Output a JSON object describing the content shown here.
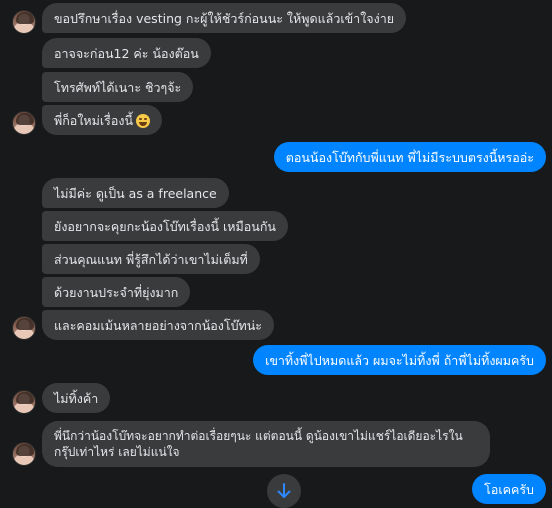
{
  "messages": [
    {
      "text": "ขอปรึกษาเรื่อง vesting กะผู้ให้ชัวร์ก่อนนะ ให้พูดแล้วเข้าใจง่าย"
    },
    {
      "text": "อาจจะก่อน12 ค่ะ น้องต๊อน"
    },
    {
      "text": "โทรศัพท์ได้เนาะ ชิวๆจ้ะ"
    },
    {
      "text": "พี่ก็อใหม่เรื่องนี้"
    },
    {
      "text": "ตอนน้องโบ๊ทกับพี่แนท พี่ไม่มีระบบตรงนี้หรออ่ะ"
    },
    {
      "text": "ไม่มีค่ะ ดูเป็น as a freelance"
    },
    {
      "text": "ยังอยากจะคุยกะน้องโบ๊ทเรื่องนี้ เหมือนกัน"
    },
    {
      "text": "ส่วนคุณแนท พี่รู้สึกได้ว่าเขาไม่เต็มที่"
    },
    {
      "text": "ด้วยงานประจำที่ยุ่งมาก"
    },
    {
      "text": "และคอมเม้นหลายอย่างจากน้องโบ๊ทน่ะ"
    },
    {
      "text": "เขาทิ้งพี่ไปหมดแล้ว ผมจะไม่ทิ้งพี่ ถ้าพี่ไม่ทิ้งผมครับ"
    },
    {
      "text": "ไม่ทิ้งค้า"
    },
    {
      "text": "พี่นึกว่าน้องโบ๊ทจะอยากทำต่อเรื่อยๆนะ แต่ตอนนี้ ดูน้องเขาไม่แชร์ไอเดียอะไรในกรุ๊ปเท่าไหร่ เลยไม่แน่ใจ"
    },
    {
      "text": "โอเคครับ"
    }
  ],
  "icons": {
    "reaction_emoji": "rolling-on-floor-laughing-emoji",
    "scroll_down": "arrow-down-icon"
  },
  "colors": {
    "background": "#18191a",
    "incoming_bubble": "#3a3b3c",
    "outgoing_bubble": "#0084ff",
    "text": "#e4e6eb"
  }
}
